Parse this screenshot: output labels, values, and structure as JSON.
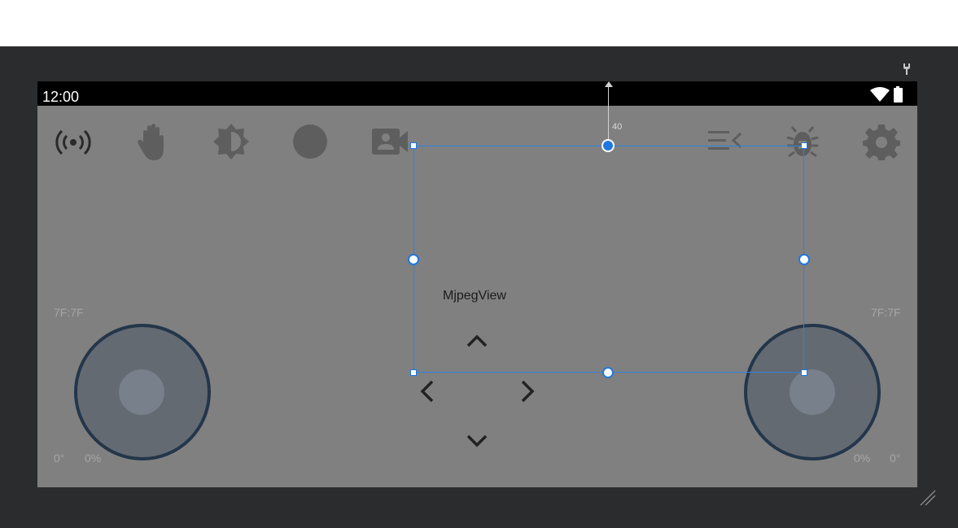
{
  "editor": {
    "pin_icon": "pin-icon",
    "resize_icon": "resize-grip-icon",
    "colors": {
      "canvas": "#2b2c2e",
      "selection": "#1f77e0"
    }
  },
  "status_bar": {
    "time": "12:00",
    "icons": [
      "wifi-icon",
      "battery-icon"
    ]
  },
  "toolbar": {
    "icons": [
      "broadcast-icon",
      "hand-icon",
      "brightness-icon",
      "record-icon",
      "video-contact-icon",
      "playlist-collapse-icon",
      "bug-icon",
      "settings-icon"
    ]
  },
  "joysticks": {
    "left": {
      "hex": "7F:7F",
      "angle": "0°",
      "power": "0%"
    },
    "right": {
      "hex": "7F:7F",
      "angle": "0°",
      "power": "0%"
    }
  },
  "dpad": {
    "icons": [
      "chevron-up-icon",
      "chevron-left-icon",
      "chevron-right-icon",
      "chevron-down-icon"
    ]
  },
  "selection": {
    "component_label": "MjpegView",
    "top_margin": "40"
  }
}
